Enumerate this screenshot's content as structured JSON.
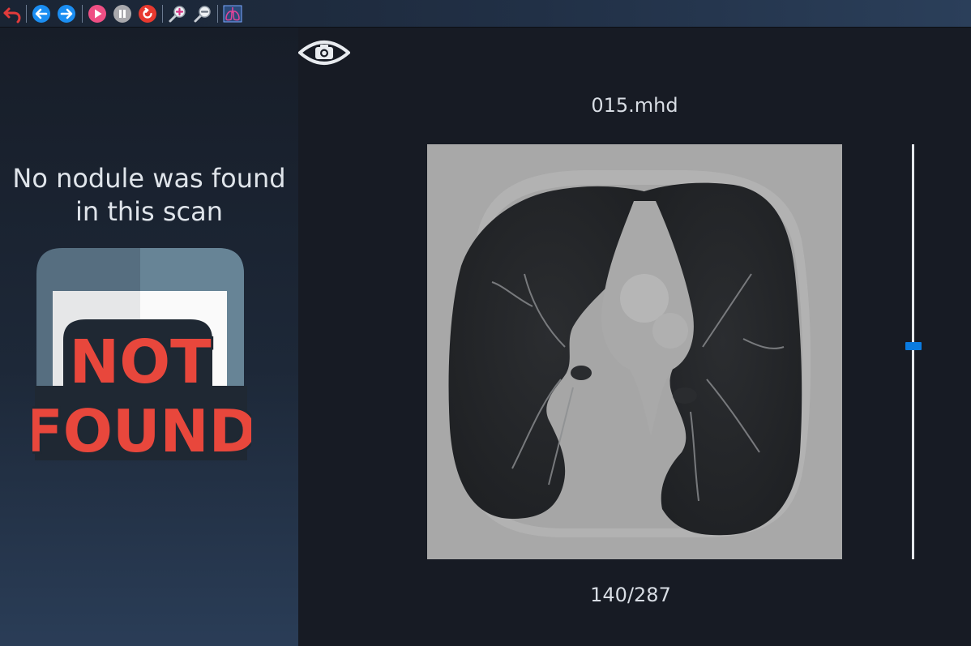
{
  "toolbar": {
    "buttons": [
      {
        "name": "undo",
        "icon": "undo-arrow-icon",
        "color": "#e23b3b"
      },
      {
        "name": "back",
        "icon": "arrow-left-icon",
        "color": "#1b8ef2"
      },
      {
        "name": "forward",
        "icon": "arrow-right-icon",
        "color": "#1b8ef2"
      },
      {
        "name": "play",
        "icon": "play-icon",
        "color": "#ef4f84"
      },
      {
        "name": "pause",
        "icon": "pause-icon",
        "color": "#a9a9ad"
      },
      {
        "name": "reset",
        "icon": "refresh-icon",
        "color": "#e8392f"
      },
      {
        "name": "zoom-in",
        "icon": "zoom-in-icon",
        "color": "#c8cdd4"
      },
      {
        "name": "zoom-out",
        "icon": "zoom-out-icon",
        "color": "#c8cdd4"
      },
      {
        "name": "lungs",
        "icon": "lungs-icon",
        "color": "#e0449a"
      }
    ]
  },
  "left_panel": {
    "message": "No nodule was found in this scan",
    "illustration": {
      "line1": "NOT",
      "line2": "FOUND",
      "text_color": "#e8473c",
      "outline_color": "#1f2833"
    }
  },
  "viewer": {
    "filename": "015.mhd",
    "slice_current": 140,
    "slice_total": 287,
    "counter_label": "140/287",
    "slider_color": "#0a7be0"
  }
}
